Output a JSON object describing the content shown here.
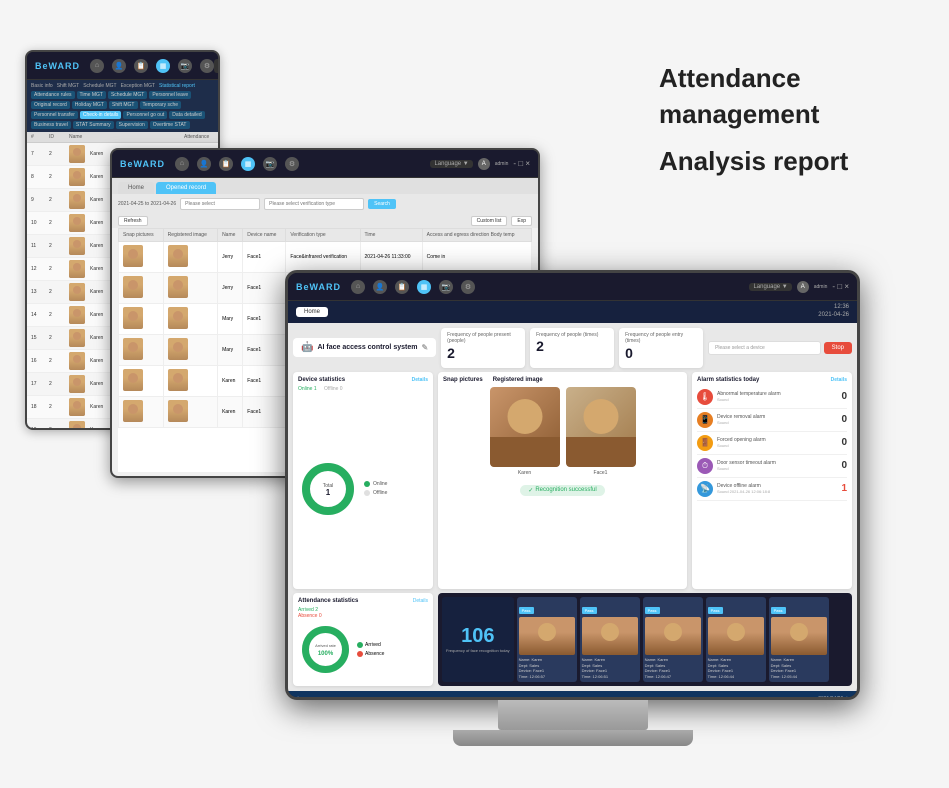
{
  "page": {
    "title": "Attendance management",
    "subtitle": "Analysis report",
    "background": "#f5f5f5"
  },
  "small_monitor": {
    "logo": "BeWARD",
    "menu_items": [
      "Basic info",
      "Shift MGT",
      "Schedule MGT",
      "Exception MGT",
      "Statistical report"
    ],
    "sub_items": [
      "Attendance rules",
      "Time MGT",
      "Schedule MGT",
      "Personnel leave",
      "Original record"
    ],
    "sub_items2": [
      "Holiday MGT",
      "Shift MGT",
      "Temporary sche",
      "Personnel transfer",
      "Check-in details"
    ],
    "sub_items3": [
      "Personnel go out",
      "Data detailed"
    ],
    "sub_items4": [
      "Business travel",
      "STAT Summary"
    ],
    "sub_items5": [
      "Supervision",
      "Overtime STAT"
    ],
    "left_label": "Attendance",
    "list_rows": [
      {
        "num": "7",
        "id": "2",
        "name": "Karen"
      },
      {
        "num": "8",
        "id": "2",
        "name": "Karen"
      },
      {
        "num": "9",
        "id": "2",
        "name": "Karen"
      },
      {
        "num": "10",
        "id": "2",
        "name": "Karen"
      },
      {
        "num": "11",
        "id": "2",
        "name": "Karen"
      },
      {
        "num": "12",
        "id": "2",
        "name": "Karen"
      },
      {
        "num": "13",
        "id": "2",
        "name": "Karen"
      },
      {
        "num": "14",
        "id": "2",
        "name": "Karen"
      },
      {
        "num": "15",
        "id": "2",
        "name": "Karen"
      },
      {
        "num": "16",
        "id": "2",
        "name": "Karen"
      },
      {
        "num": "17",
        "id": "2",
        "name": "Karen"
      },
      {
        "num": "18",
        "id": "2",
        "name": "Karen"
      },
      {
        "num": "19",
        "id": "2",
        "name": "Karen"
      }
    ]
  },
  "medium_monitor": {
    "logo": "BeWARD",
    "tab_home": "Home",
    "tab_opened": "Opened record",
    "date_range": "2021-04-25 to 2021-04-26",
    "search_placeholder": "Please select a device",
    "btn_search": "Search",
    "btn_custom": "Custom list",
    "btn_refresh": "Refresh",
    "btn_export": "Exp",
    "table_headers": [
      "Snap pictures",
      "Registered image",
      "Name",
      "Device name",
      "Verification type",
      "Time",
      "Access and egress direction  Body temperature"
    ],
    "rows": [
      {
        "name": "Jerry",
        "device": "Face1",
        "verif": "Face&infrared verification",
        "time": "2021-04-26 11:33:00",
        "dir": "Come in"
      },
      {
        "name": "Jerry",
        "device": "Face1",
        "verif": "",
        "time": ""
      },
      {
        "name": "Mary",
        "device": "Face1",
        "verif": "",
        "time": ""
      },
      {
        "name": "Mary",
        "device": "Face1",
        "verif": "",
        "time": ""
      },
      {
        "name": "Karen",
        "device": "Face1",
        "verif": "",
        "time": ""
      },
      {
        "name": "Karen",
        "device": "Face1",
        "verif": "",
        "time": ""
      }
    ]
  },
  "large_monitor": {
    "logo": "BeWARD",
    "time": "12:36",
    "date": "2021-04-26",
    "home_btn": "Home",
    "system_title": "AI face access control system",
    "freq_present_label": "Frequency of people present (people)",
    "freq_present_value": "2",
    "freq_times_label": "Frequency of people (times)",
    "freq_times_value": "2",
    "freq_exit_label": "Frequency of people entry (times)",
    "freq_exit_value": "0",
    "device_placeholder": "Please select a device",
    "stop_btn": "Stop",
    "device_stats_title": "Device statistics",
    "device_detail": "Details",
    "device_online_label": "Online 1",
    "device_offline_label": "Offline 0",
    "device_total": "Total",
    "device_total_value": "1",
    "snap_pictures": "Snap pictures",
    "registered_image": "Registered image",
    "recognition_text": "Recognition successful",
    "person_name": "Karen",
    "face_name": "Face1",
    "alarm_title": "Alarm statistics today",
    "alarm_details": "Details",
    "alarm_items": [
      {
        "type": "temp",
        "label": "Abnormal temperature alarm",
        "count": "0"
      },
      {
        "type": "device",
        "label": "Device removal alarm",
        "count": "0"
      },
      {
        "type": "forced",
        "label": "Forced opening alarm",
        "count": "0"
      },
      {
        "type": "door",
        "label": "Door sensor timeout alarm",
        "count": "0"
      },
      {
        "type": "offline",
        "label": "Device offline alarm",
        "count": "1"
      }
    ],
    "attendance_title": "Attendance statistics",
    "attendance_detail": "Details",
    "arrived": "Arrived 2",
    "absent": "Absence 0",
    "arrival_rate": "Arrived rate",
    "arrival_rate_value": "100%",
    "face_strip_count": "106",
    "face_strip_label": "Frequency of face recognition today",
    "face_thumbs": [
      {
        "badge": "Pass",
        "name": "Karen",
        "dept": "Sales",
        "device": "Face1",
        "time": "12:06:57"
      },
      {
        "badge": "Pass",
        "name": "Karen",
        "dept": "Sales",
        "device": "Face1",
        "time": "12:06:51"
      },
      {
        "badge": "Pass",
        "name": "Karen",
        "dept": "Sales",
        "device": "Face1",
        "time": "12:06:47"
      },
      {
        "badge": "Pass",
        "name": "Karen",
        "dept": "Sales",
        "device": "Face1",
        "time": "12:06:44"
      }
    ]
  }
}
